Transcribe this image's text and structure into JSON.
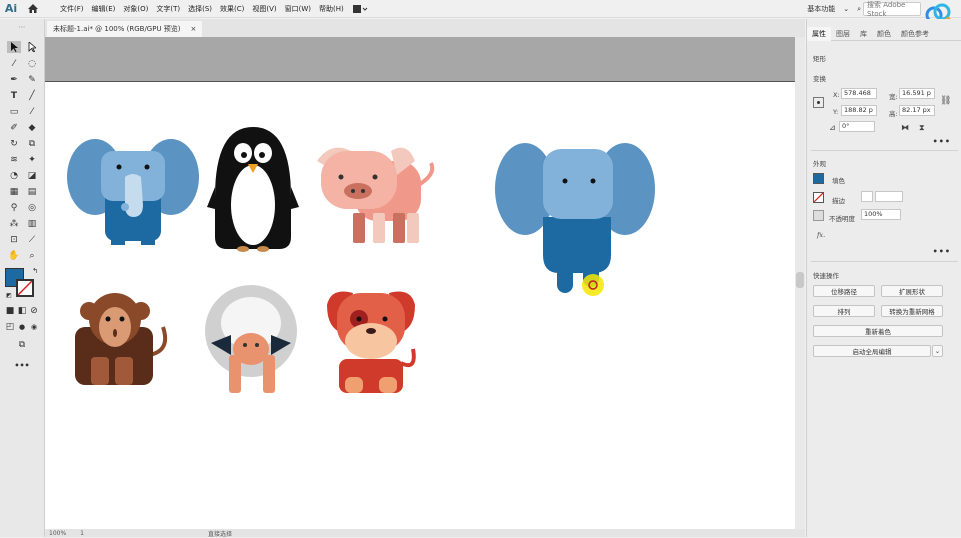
{
  "app": {
    "logo": "Ai"
  },
  "menu": {
    "items": [
      "文件(F)",
      "编辑(E)",
      "对象(O)",
      "文字(T)",
      "选择(S)",
      "效果(C)",
      "视图(V)",
      "窗口(W)",
      "帮助(H)"
    ],
    "workspace": "基本功能",
    "search_placeholder": "搜索 Adobe Stock"
  },
  "doc_tab": {
    "title": "未标题-1.ai* @ 100% (RGB/GPU 预览)",
    "close": "×"
  },
  "panel": {
    "tabs": [
      "属性",
      "图层",
      "库",
      "颜色",
      "颜色参考"
    ],
    "selection_type": "矩形",
    "transform_title": "变换",
    "x_label": "X:",
    "x_value": "578.468",
    "y_label": "Y:",
    "y_value": "188.82 p",
    "w_label": "宽:",
    "w_value": "16.591 p",
    "h_label": "高:",
    "h_value": "82.17 px",
    "angle_value": "0°",
    "appearance_title": "外观",
    "fill_label": "填色",
    "stroke_label": "描边",
    "opacity_label": "不透明度",
    "opacity_value": "100%",
    "fx_label": "fx.",
    "quick_actions_title": "快速操作",
    "btn_offset_path": "位移路径",
    "btn_expand_shape": "扩展形状",
    "btn_arrange": "排列",
    "btn_convert_mesh": "转换为重新网格",
    "btn_recolor": "重新着色",
    "btn_global_edit": "启动全局编辑",
    "more": "•••"
  },
  "status": {
    "zoom": "100%",
    "page": "1",
    "tool_name": "直接选择"
  },
  "colors": {
    "accent_fill": "#1d6aa3",
    "elephant_ear": "#5b93c2",
    "elephant_face": "#82b2d9",
    "elephant_body": "#1d6aa3"
  }
}
